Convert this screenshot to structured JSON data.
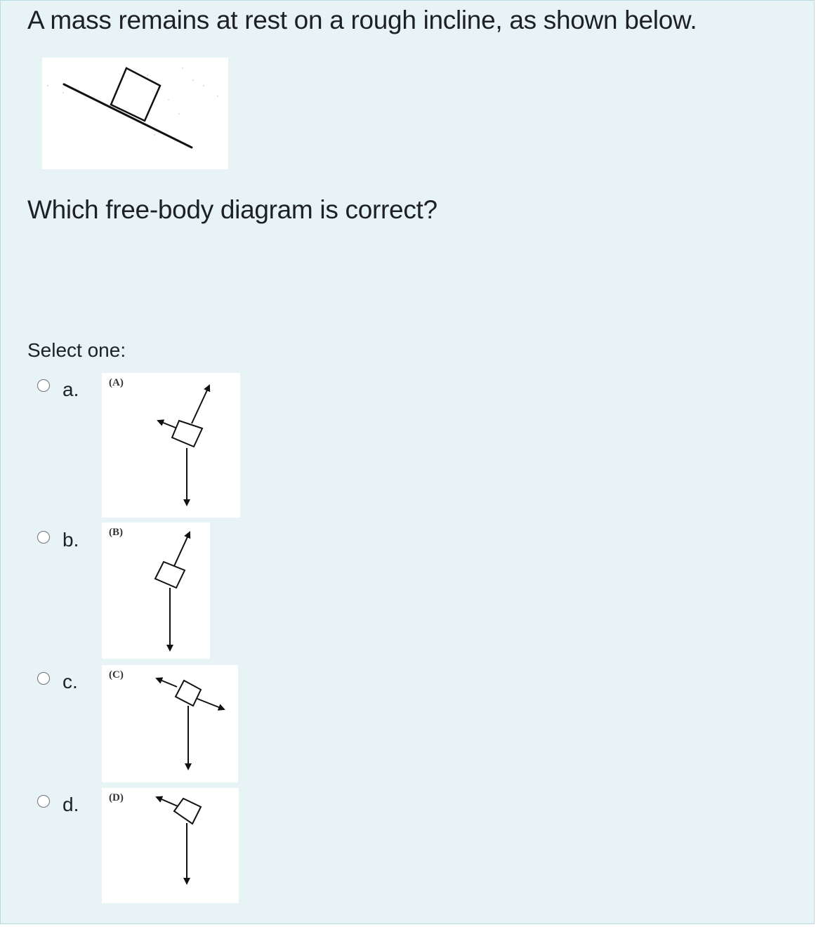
{
  "question": {
    "text": "A mass remains at rest on a rough incline, as shown below.",
    "image_alt": "block on rough incline",
    "prompt": "Which free-body diagram is correct?"
  },
  "answer": {
    "instruction": "Select one:",
    "options": [
      {
        "letter": "a.",
        "diagram_label": "(A)",
        "forces": [
          "normal (perpendicular up-right)",
          "friction (up the incline)",
          "weight (down)"
        ],
        "selected": false
      },
      {
        "letter": "b.",
        "diagram_label": "(B)",
        "forces": [
          "normal (perpendicular up-right)",
          "weight (down)"
        ],
        "selected": false
      },
      {
        "letter": "c.",
        "diagram_label": "(C)",
        "forces": [
          "friction (up the incline)",
          "force down the incline",
          "weight (down)"
        ],
        "selected": false
      },
      {
        "letter": "d.",
        "diagram_label": "(D)",
        "forces": [
          "friction (up the incline)",
          "weight (down)"
        ],
        "selected": false
      }
    ]
  },
  "colors": {
    "panel_bg": "#e7f3f5",
    "panel_border": "#b8dce2",
    "text": "#1d2125"
  }
}
